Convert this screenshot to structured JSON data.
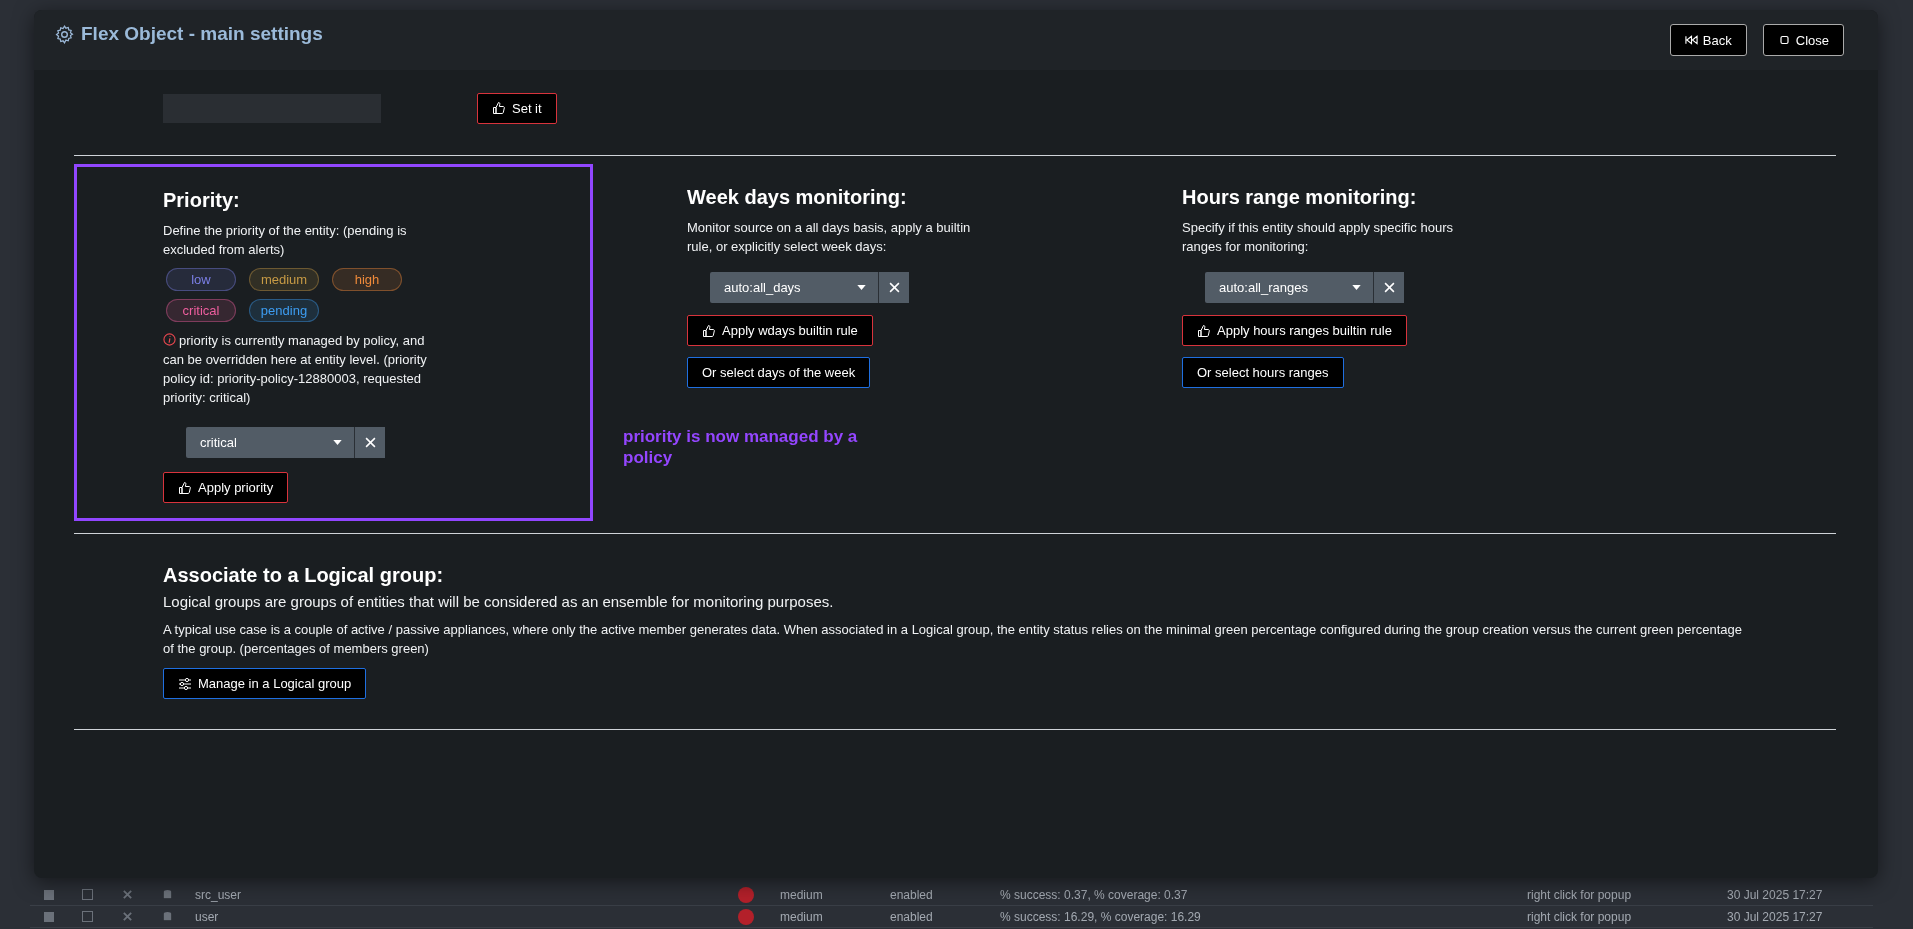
{
  "modal": {
    "title": "Flex Object - main settings",
    "buttons": [
      {
        "label": "Back",
        "kind": "back"
      },
      {
        "label": "Close",
        "kind": "close"
      }
    ]
  },
  "top_row": {
    "button": "Set it"
  },
  "priority": {
    "heading": "Priority:",
    "description": "Define the priority of the entity: (pending is excluded from alerts)",
    "tags": [
      {
        "label": "low",
        "color": "#7b7fe6"
      },
      {
        "label": "medium",
        "color": "#c79a45"
      },
      {
        "label": "high",
        "color": "#ef8a3a"
      },
      {
        "label": "critical",
        "color": "#ee5e9e"
      },
      {
        "label": "pending",
        "color": "#3d9df2"
      }
    ],
    "notice": "priority is currently managed by policy, and can be overridden here at entity level. (priority policy id: priority-policy-12880003, requested priority: critical)",
    "select": {
      "value": "critical"
    },
    "button": "Apply priority"
  },
  "annotation": "priority is now managed by a policy",
  "weekdays": {
    "heading": "Week days monitoring:",
    "description": "Monitor source on a all days basis, apply a builtin rule, or explicitly select week days:",
    "select": {
      "value": "auto:all_days"
    },
    "buttons": [
      {
        "label": "Apply wdays builtin rule",
        "kind": "apply"
      },
      {
        "label": "Or select days of the week",
        "kind": "select"
      }
    ]
  },
  "hours": {
    "heading": "Hours range monitoring:",
    "description": "Specify if this entity should apply specific hours ranges for monitoring:",
    "select": {
      "value": "auto:all_ranges"
    },
    "buttons": [
      {
        "label": "Apply hours ranges builtin rule",
        "kind": "apply"
      },
      {
        "label": "Or select hours ranges",
        "kind": "select"
      }
    ]
  },
  "logical_group": {
    "heading": "Associate to a Logical group:",
    "lead": "Logical groups are groups of entities that will be considered as an ensemble for monitoring purposes.",
    "description": "A typical use case is a couple of active / passive appliances, where only the active member generates data. When associated in a Logical group, the entity status relies on the minimal green percentage configured during the group creation versus the current green percentage of the group. (percentages of members green)",
    "button": "Manage in a Logical group"
  },
  "background_rows": [
    {
      "name": "src_user",
      "priority": "medium",
      "state": "enabled",
      "metrics": "% success: 0.37, % coverage: 0.37",
      "hint": "right click for popup",
      "date": "30 Jul 2025 17:27"
    },
    {
      "name": "user",
      "priority": "medium",
      "state": "enabled",
      "metrics": "% success: 16.29, % coverage: 16.29",
      "hint": "right click for popup",
      "date": "30 Jul 2025 17:27"
    }
  ]
}
